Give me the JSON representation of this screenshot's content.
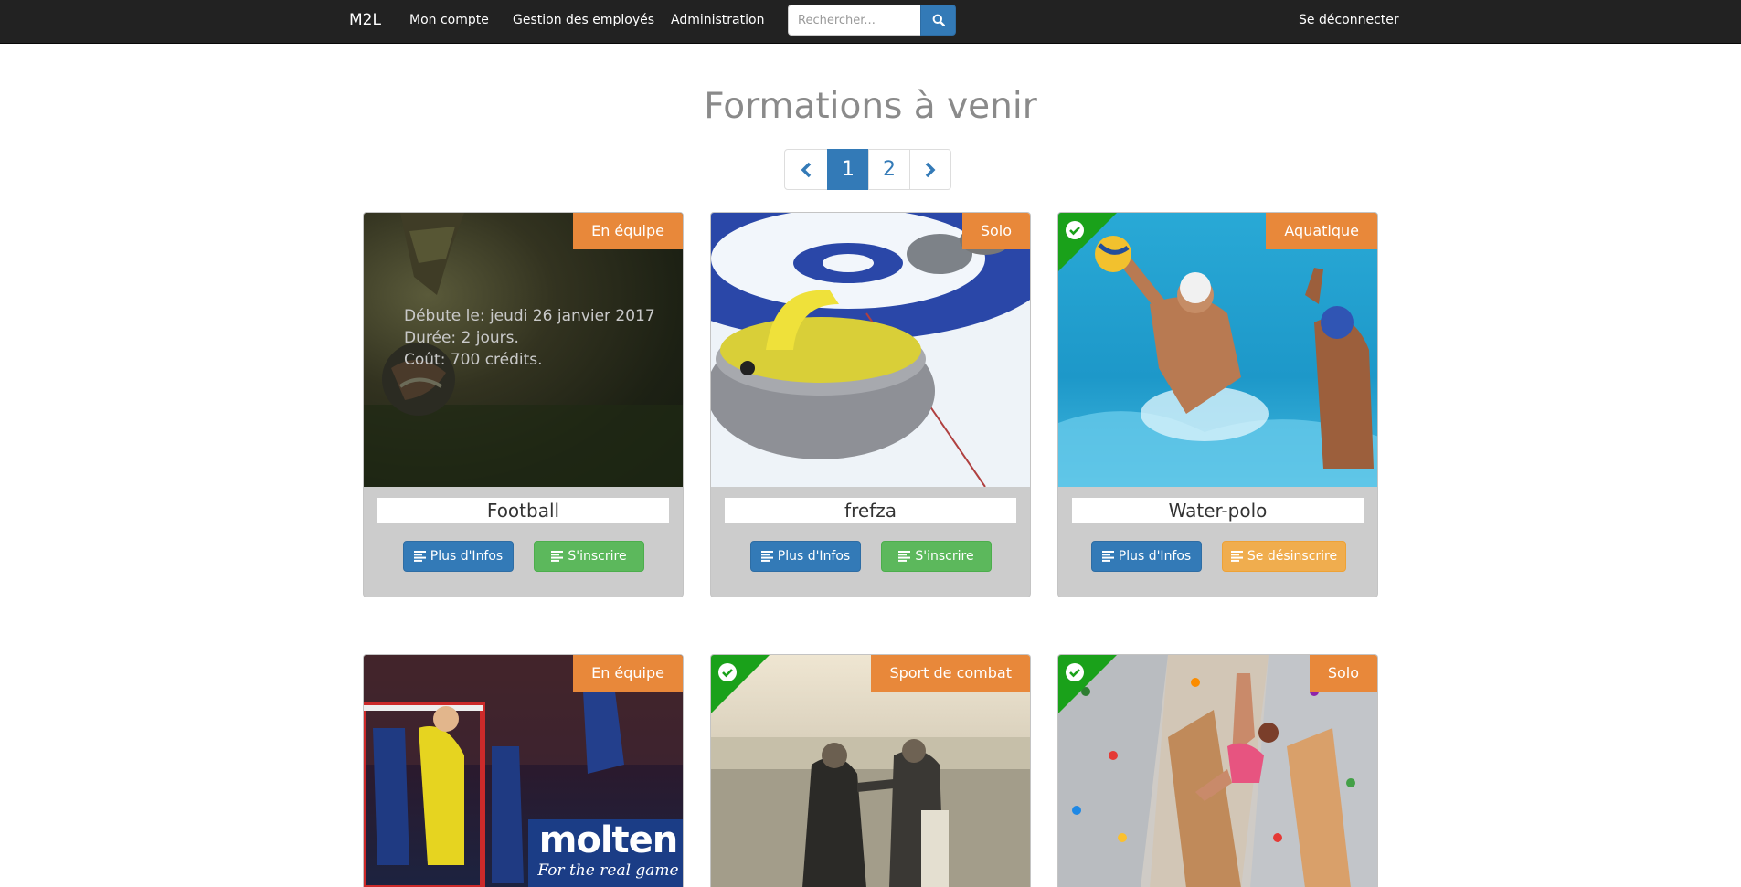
{
  "navbar": {
    "brand": "M2L",
    "links": [
      "Mon compte",
      "Gestion des employés",
      "Administration"
    ],
    "search_placeholder": "Rechercher...",
    "logout": "Se déconnecter"
  },
  "page": {
    "title": "Formations à venir"
  },
  "pagination": {
    "pages": [
      "1",
      "2"
    ],
    "current": "1"
  },
  "cards": [
    {
      "name": "Football",
      "category": "En équipe",
      "registered": false,
      "details": [
        "Débute le: jeudi 26 janvier 2017",
        "Durée: 2 jours.",
        "Coût: 700 crédits."
      ],
      "info_label": "Plus d'Infos",
      "action_label": "S'inscrire"
    },
    {
      "name": "frefza",
      "category": "Solo",
      "registered": false,
      "info_label": "Plus d'Infos",
      "action_label": "S'inscrire"
    },
    {
      "name": "Water-polo",
      "category": "Aquatique",
      "registered": true,
      "info_label": "Plus d'Infos",
      "action_label": "Se désinscrire"
    },
    {
      "category": "En équipe",
      "registered": false,
      "logo_text": "molten",
      "logo_subtext": "For the real game"
    },
    {
      "category": "Sport de combat",
      "registered": true
    },
    {
      "category": "Solo",
      "registered": true
    }
  ],
  "colors": {
    "navbar": "#222222",
    "primary": "#337ab7",
    "success": "#5cb85c",
    "warning": "#f0ad4e",
    "badge": "#e8883a",
    "registered_corner": "#1aa11a"
  }
}
